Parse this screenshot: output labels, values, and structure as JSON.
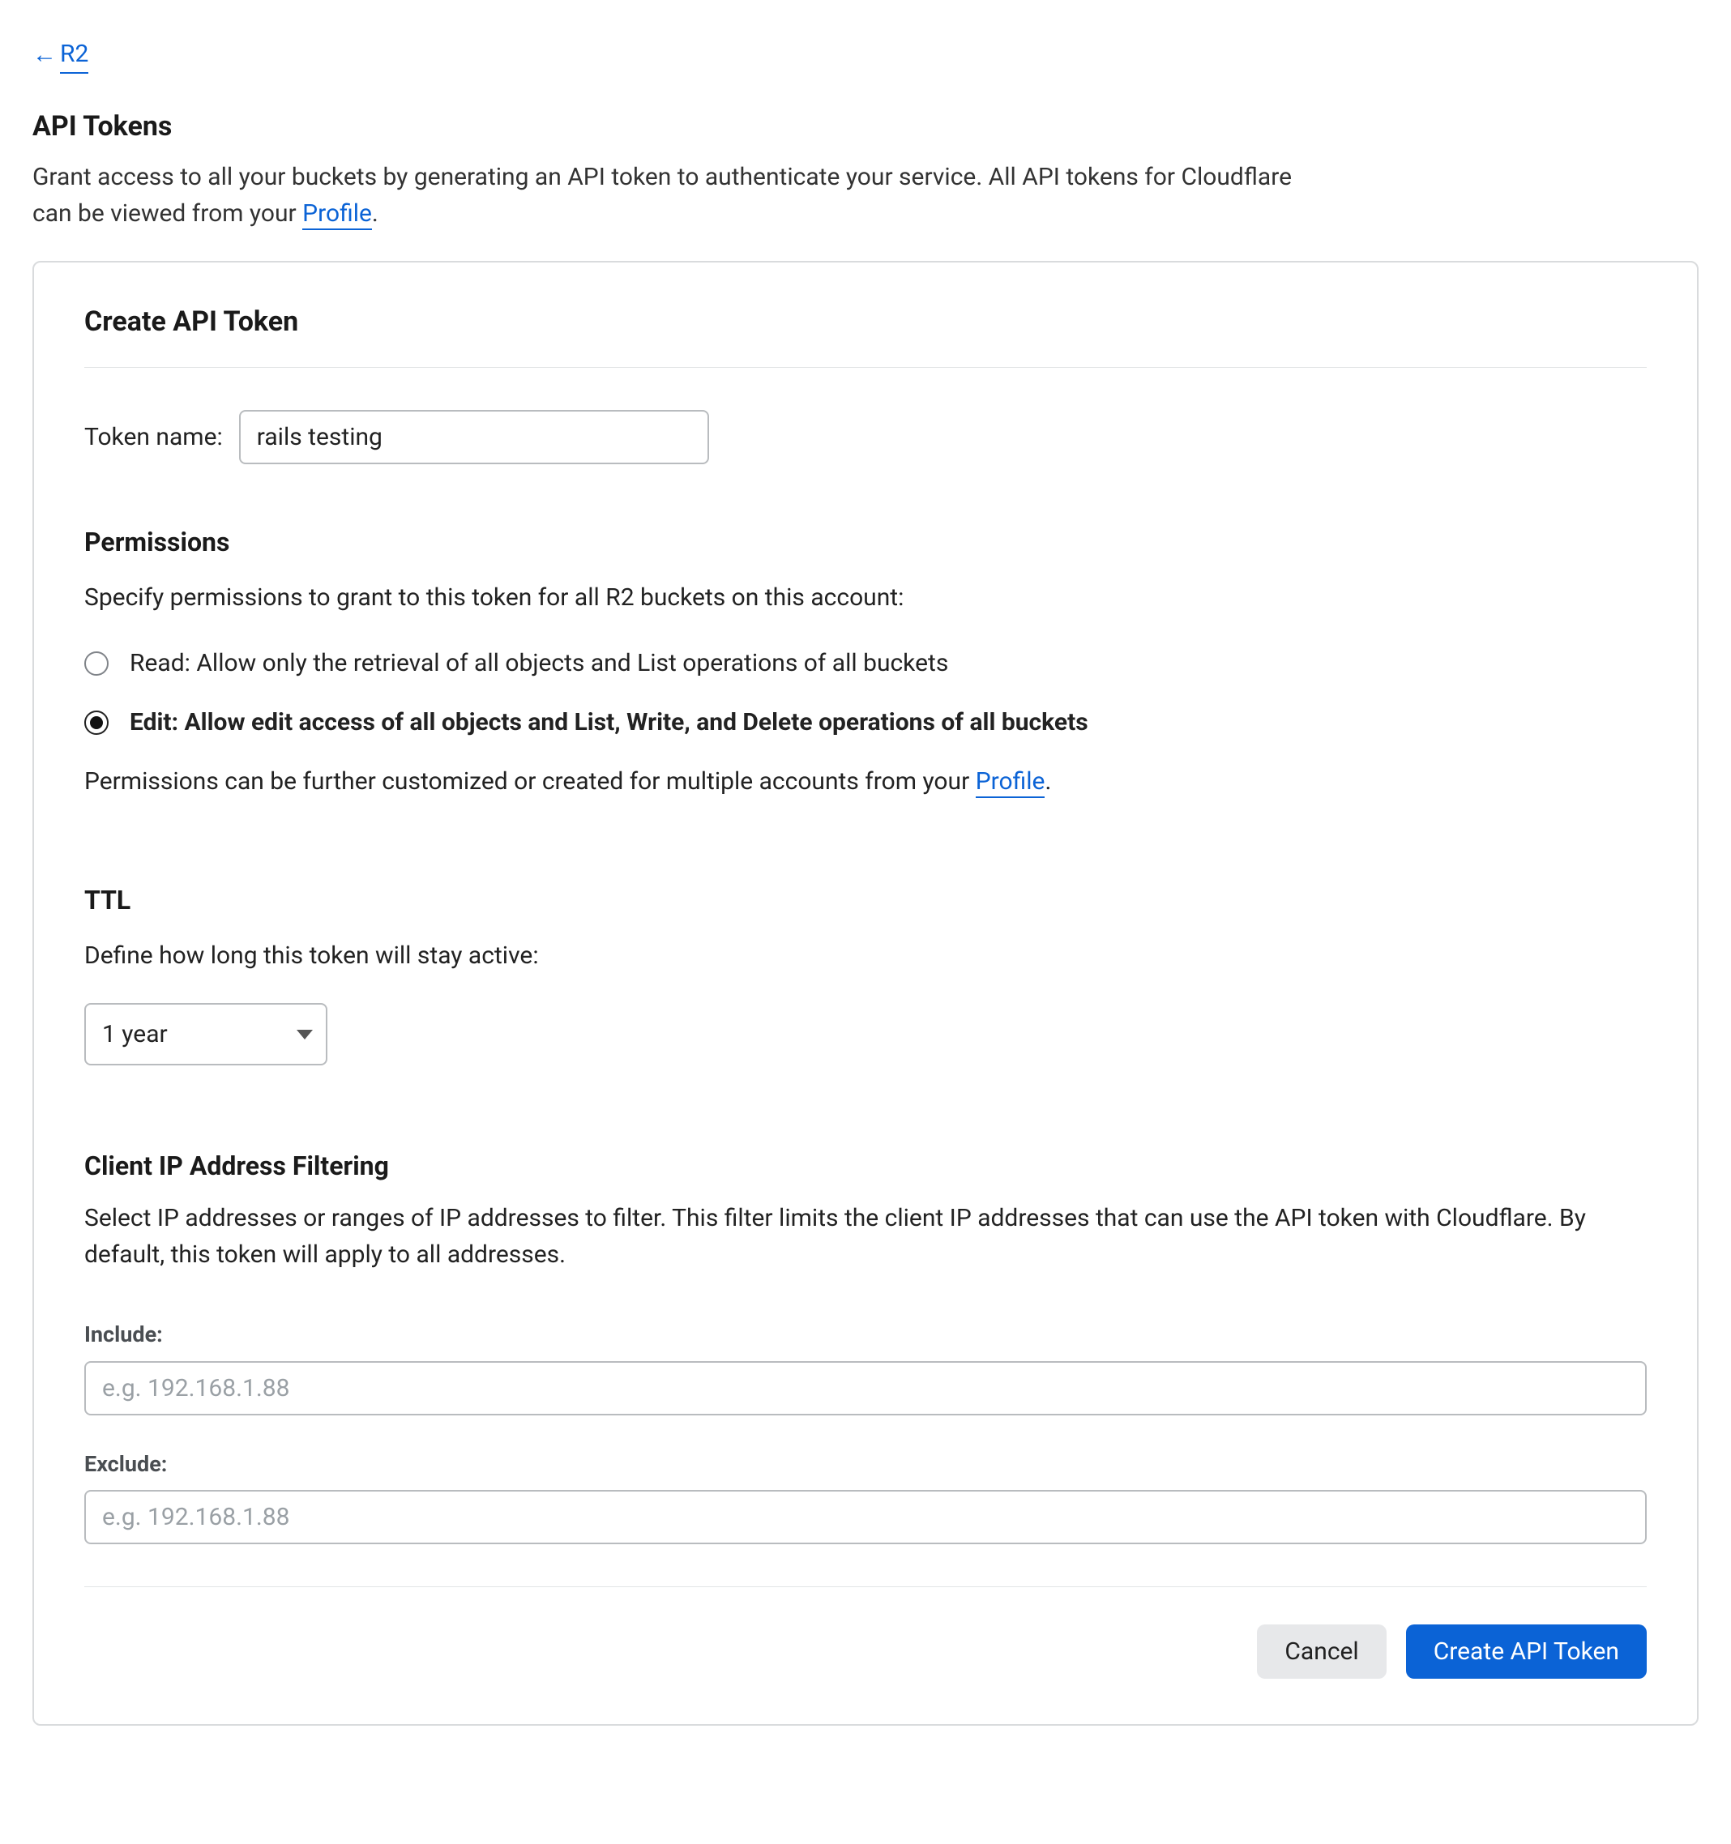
{
  "back": {
    "label": "R2"
  },
  "header": {
    "title": "API Tokens",
    "description_pre": "Grant access to all your buckets by generating an API token to authenticate your service. All API tokens for Cloudflare can be viewed from your ",
    "description_link": "Profile",
    "description_post": "."
  },
  "form": {
    "title": "Create API Token",
    "token_name": {
      "label": "Token name:",
      "value": "rails testing"
    },
    "permissions": {
      "heading": "Permissions",
      "description": "Specify permissions to grant to this token for all R2 buckets on this account:",
      "options": [
        {
          "label": "Read: Allow only the retrieval of all objects and List operations of all buckets",
          "selected": false
        },
        {
          "label": "Edit: Allow edit access of all objects and List, Write, and Delete operations of all buckets",
          "selected": true
        }
      ],
      "note_pre": "Permissions can be further customized or created for multiple accounts from your ",
      "note_link": "Profile",
      "note_post": "."
    },
    "ttl": {
      "heading": "TTL",
      "description": "Define how long this token will stay active:",
      "value": "1 year"
    },
    "ip_filter": {
      "heading": "Client IP Address Filtering",
      "description": "Select IP addresses or ranges of IP addresses to filter. This filter limits the client IP addresses that can use the API token with Cloudflare. By default, this token will apply to all addresses.",
      "include": {
        "label": "Include:",
        "placeholder": "e.g. 192.168.1.88",
        "value": ""
      },
      "exclude": {
        "label": "Exclude:",
        "placeholder": "e.g. 192.168.1.88",
        "value": ""
      }
    },
    "actions": {
      "cancel": "Cancel",
      "submit": "Create API Token"
    }
  }
}
